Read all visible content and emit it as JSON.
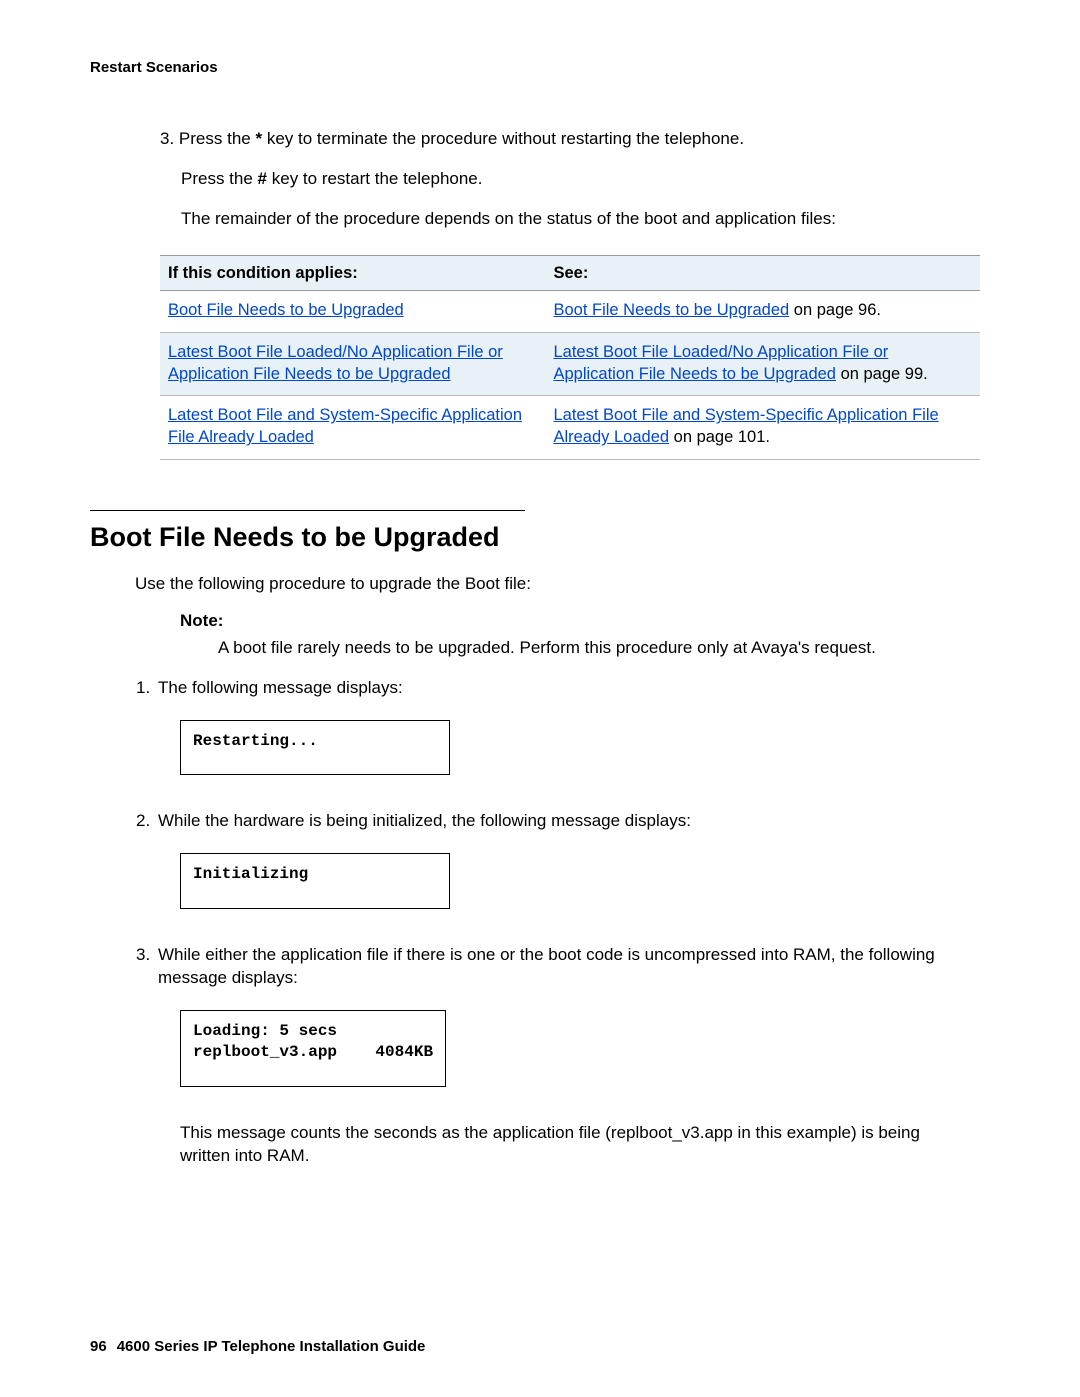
{
  "header": {
    "title": "Restart Scenarios"
  },
  "step3": {
    "number": "3.",
    "line1_a": "Press the ",
    "line1_key": "*",
    "line1_b": " key to terminate the procedure without restarting the telephone.",
    "line2_a": "Press the ",
    "line2_key": "#",
    "line2_b": " key to restart the telephone.",
    "line3": "The remainder of the procedure depends on the status of the boot and application files:"
  },
  "table": {
    "head_left": "If this condition applies:",
    "head_right": "See:",
    "rows": [
      {
        "left_link": "Boot File Needs to be Upgraded",
        "right_link": "Boot File Needs to be Upgraded",
        "right_suffix": " on page 96."
      },
      {
        "left_link": "Latest Boot File Loaded/No Application File or Application File Needs to be Upgraded",
        "right_link": "Latest Boot File Loaded/No Application File or Application File Needs to be Upgraded",
        "right_suffix": " on page 99."
      },
      {
        "left_link": "Latest Boot File and System-Specific Application File Already Loaded",
        "right_link": "Latest Boot File and System-Specific Application File Already Loaded",
        "right_suffix": " on page 101."
      }
    ]
  },
  "section": {
    "heading": "Boot File Needs to be Upgraded",
    "intro": "Use the following procedure to upgrade the Boot file:",
    "note_label": "Note:",
    "note_body": "A boot file rarely needs to be upgraded. Perform this procedure only at Avaya's request.",
    "steps": [
      {
        "num": "1.",
        "text": "The following message displays:",
        "box": "Restarting..."
      },
      {
        "num": "2.",
        "text": "While the hardware is being initialized, the following message displays:",
        "box": "Initializing"
      },
      {
        "num": "3.",
        "text": "While either the application file if there is one or the boot code is uncompressed into RAM, the following message displays:",
        "box": "Loading: 5 secs\nreplboot_v3.app    4084KB"
      }
    ],
    "post_box": "This message counts the seconds as the application file (replboot_v3.app in this example) is being written into RAM."
  },
  "footer": {
    "page": "96",
    "title": "4600 Series IP Telephone Installation Guide"
  }
}
